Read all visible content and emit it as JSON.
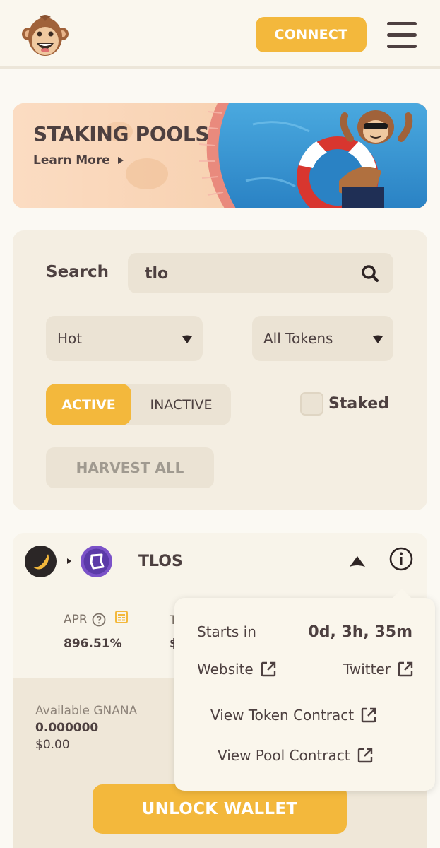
{
  "header": {
    "connect_label": "CONNECT",
    "logo_icon": "monkey-logo-icon",
    "menu_icon": "hamburger-menu-icon"
  },
  "banner": {
    "title": "STAKING POOLS",
    "link_label": "Learn More"
  },
  "filters": {
    "search_label": "Search",
    "search_value": "tlo",
    "sort_selected": "Hot",
    "tokens_selected": "All Tokens",
    "toggle_active": "ACTIVE",
    "toggle_inactive": "INACTIVE",
    "staked_label": "Staked",
    "harvest_label": "HARVEST ALL"
  },
  "pool": {
    "name": "TLOS",
    "apr_label": "APR",
    "apr_value": "896.51%",
    "stat2_label_fragment": "T",
    "stat2_value_fragment": "$",
    "available_label": "Available GNANA",
    "available_amount": "0.000000",
    "available_usd": "$0.00",
    "unlock_label": "UNLOCK WALLET"
  },
  "tooltip": {
    "starts_label": "Starts in",
    "starts_value": "0d, 3h, 35m",
    "website_label": "Website",
    "twitter_label": "Twitter",
    "token_contract_label": "View Token Contract",
    "pool_contract_label": "View Pool Contract"
  },
  "colors": {
    "accent": "#f3b83c",
    "text": "#4d4040",
    "panel": "#f4eee2",
    "input": "#ebe3d4"
  }
}
